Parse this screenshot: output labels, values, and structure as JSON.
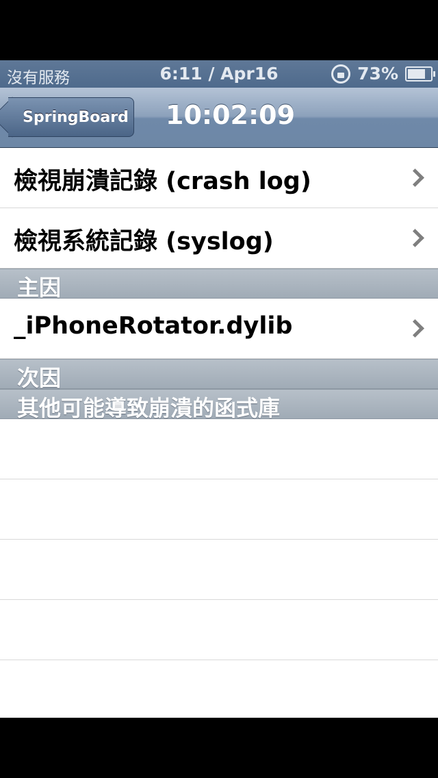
{
  "status_bar": {
    "carrier": "沒有服務",
    "time": "6:11 / Apr16",
    "battery_pct": "73%"
  },
  "nav": {
    "back_label": "SpringBoard",
    "title": "10:02:09"
  },
  "rows": [
    {
      "label": "檢視崩潰記錄 (crash log)"
    },
    {
      "label": "檢視系統記錄 (syslog)"
    }
  ],
  "sections": {
    "primary": {
      "label": "主因",
      "items": [
        {
          "label": "_iPhoneRotator.dylib"
        }
      ]
    },
    "secondary": {
      "label": "次因"
    },
    "other": {
      "label": "其他可能導致崩潰的函式庫"
    }
  },
  "icons": {
    "lock": "orientation-lock-icon",
    "battery": "battery-icon",
    "chevron": "chevron-right-icon"
  }
}
